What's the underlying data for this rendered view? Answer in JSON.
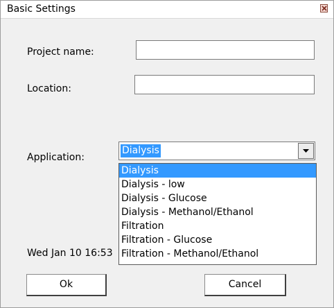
{
  "window": {
    "title": "Basic Settings"
  },
  "form": {
    "project_name_label": "Project name:",
    "project_name_value": "",
    "location_label": "Location:",
    "location_value": "",
    "application_label": "Application:",
    "application_value": "Dialysis"
  },
  "dropdown": {
    "options": [
      "Dialysis",
      "Dialysis - low",
      "Dialysis - Glucose",
      "Dialysis - Methanol/Ethanol",
      "Filtration",
      "Filtration - Glucose",
      "Filtration - Methanol/Ethanol"
    ],
    "selected_index": 0
  },
  "status": {
    "date_text": "Wed Jan 10 16:53"
  },
  "buttons": {
    "ok_label": "Ok",
    "cancel_label": "Cancel"
  },
  "colors": {
    "selection": "#3399ff",
    "dialog_bg": "#f0f0f0"
  },
  "icons": {
    "close": "close-icon",
    "dropdown": "chevron-down-icon"
  }
}
